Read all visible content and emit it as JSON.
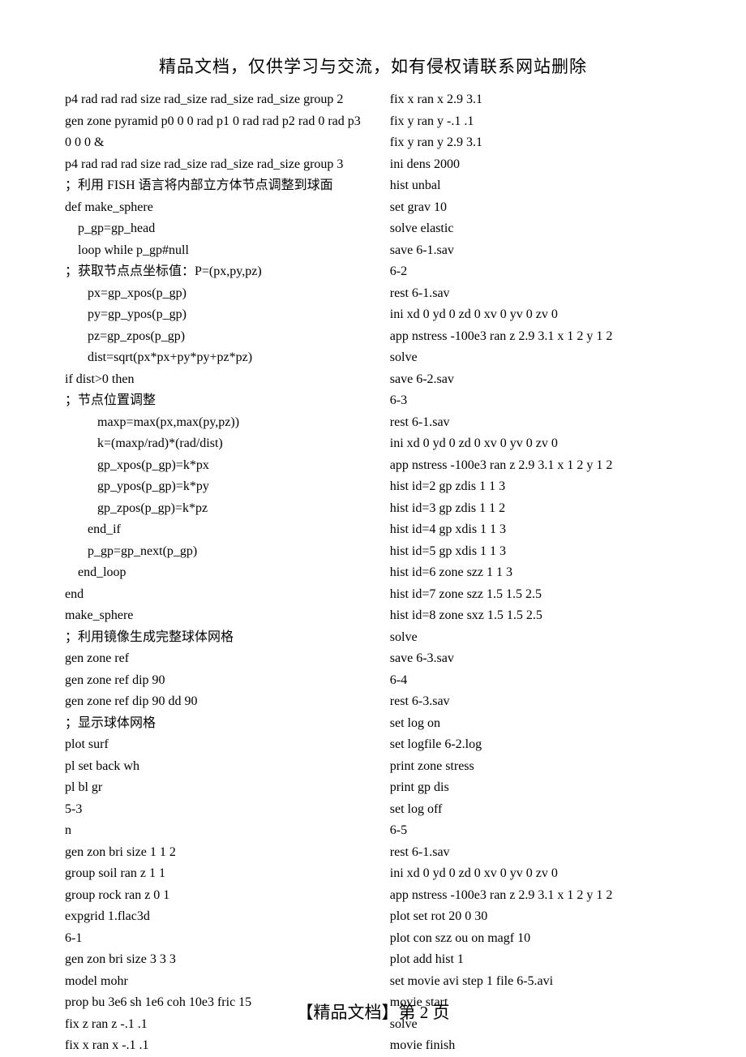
{
  "header": "精品文档，仅供学习与交流，如有侵权请联系网站删除",
  "footer": "【精品文档】第 2 页",
  "leftColumn": [
    "p4 rad rad rad size rad_size rad_size rad_size group 2",
    "gen zone pyramid p0 0 0 rad p1 0 rad rad p2 rad 0 rad p3",
    "0 0 0 &",
    "p4 rad rad rad size rad_size rad_size rad_size group 3",
    "；利用 FISH 语言将内部立方体节点调整到球面",
    "def make_sphere",
    "    p_gp=gp_head",
    "    loop while p_gp#null",
    "；获取节点点坐标值：P=(px,py,pz)",
    "       px=gp_xpos(p_gp)",
    "       py=gp_ypos(p_gp)",
    "       pz=gp_zpos(p_gp)",
    "       dist=sqrt(px*px+py*py+pz*pz)",
    "if dist>0 then",
    "；节点位置调整",
    "          maxp=max(px,max(py,pz))",
    "          k=(maxp/rad)*(rad/dist)",
    "          gp_xpos(p_gp)=k*px",
    "          gp_ypos(p_gp)=k*py",
    "          gp_zpos(p_gp)=k*pz",
    "       end_if",
    "       p_gp=gp_next(p_gp)",
    "    end_loop",
    "end",
    "make_sphere",
    "；利用镜像生成完整球体网格",
    "gen zone ref",
    "gen zone ref dip 90",
    "gen zone ref dip 90 dd 90",
    "；显示球体网格",
    "plot surf",
    "pl set back wh",
    "pl bl gr",
    "5-3",
    "n",
    "gen zon bri size 1 1 2",
    "group soil ran z 1 1",
    "group rock ran z 0 1",
    "expgrid 1.flac3d",
    "6-1",
    "gen zon bri size 3 3 3",
    "model mohr",
    "prop bu 3e6 sh 1e6 coh 10e3 fric 15",
    "fix z ran z -.1 .1",
    "fix x ran x -.1 .1"
  ],
  "rightColumn": [
    "fix x ran x 2.9 3.1",
    "fix y ran y -.1 .1",
    "fix y ran y 2.9 3.1",
    "ini dens 2000",
    "hist unbal",
    "set grav 10",
    "solve elastic",
    "save 6-1.sav",
    "6-2",
    "rest 6-1.sav",
    "ini xd 0 yd 0 zd 0 xv 0 yv 0 zv 0",
    "app nstress -100e3 ran z 2.9 3.1 x 1 2 y 1 2",
    "solve",
    "save 6-2.sav",
    "6-3",
    "rest 6-1.sav",
    "ini xd 0 yd 0 zd 0 xv 0 yv 0 zv 0",
    "app nstress -100e3 ran z 2.9 3.1 x 1 2 y 1 2",
    "hist id=2 gp zdis 1 1 3",
    "hist id=3 gp zdis 1 1 2",
    "hist id=4 gp xdis 1 1 3",
    "hist id=5 gp xdis 1 1 3",
    "hist id=6 zone szz 1 1 3",
    "hist id=7 zone szz 1.5 1.5 2.5",
    "hist id=8 zone sxz 1.5 1.5 2.5",
    "solve",
    "save 6-3.sav",
    "6-4",
    "rest 6-3.sav",
    "set log on",
    "set logfile 6-2.log",
    "print zone stress",
    "print gp dis",
    "set log off",
    "6-5",
    "rest 6-1.sav",
    "ini xd 0 yd 0 zd 0 xv 0 yv 0 zv 0",
    "app nstress -100e3 ran z 2.9 3.1 x 1 2 y 1 2",
    "plot set rot 20 0 30",
    "plot con szz ou on magf 10",
    "plot add hist 1",
    "set movie avi step 1 file 6-5.avi",
    "movie start",
    "solve",
    "movie finish"
  ]
}
